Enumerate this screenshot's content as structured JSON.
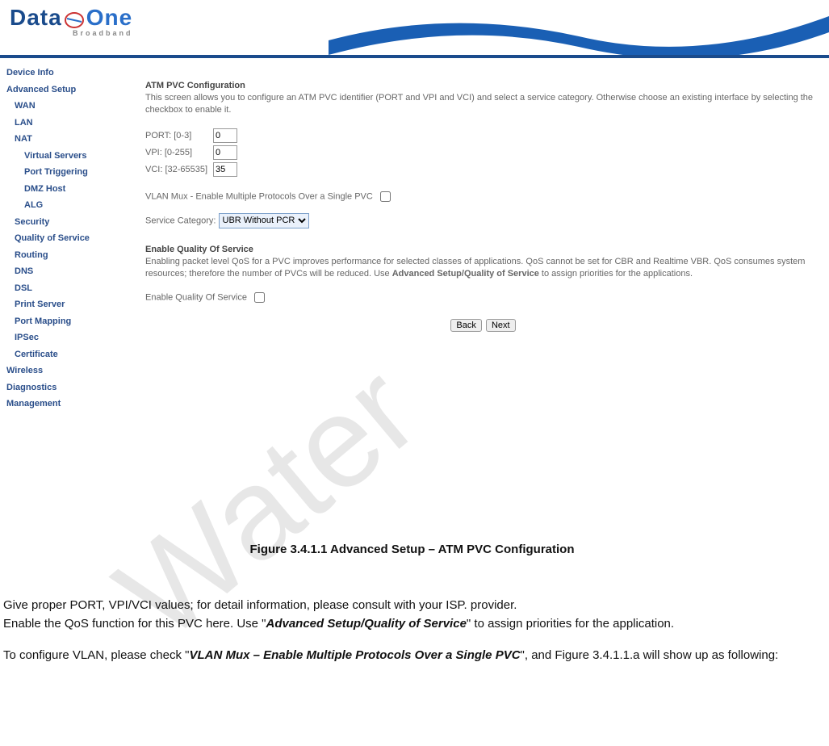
{
  "banner": {
    "logo_main": "Data",
    "logo_accent": "One",
    "logo_sub": "Broadband"
  },
  "sidebar": {
    "items": [
      {
        "label": "Device Info",
        "level": 0
      },
      {
        "label": "Advanced Setup",
        "level": 0
      },
      {
        "label": "WAN",
        "level": 1
      },
      {
        "label": "LAN",
        "level": 1
      },
      {
        "label": "NAT",
        "level": 1
      },
      {
        "label": "Virtual Servers",
        "level": 2
      },
      {
        "label": "Port Triggering",
        "level": 2
      },
      {
        "label": "DMZ Host",
        "level": 2
      },
      {
        "label": "ALG",
        "level": 2
      },
      {
        "label": "Security",
        "level": 1
      },
      {
        "label": "Quality of Service",
        "level": 1
      },
      {
        "label": "Routing",
        "level": 1
      },
      {
        "label": "DNS",
        "level": 1
      },
      {
        "label": "DSL",
        "level": 1
      },
      {
        "label": "Print Server",
        "level": 1
      },
      {
        "label": "Port Mapping",
        "level": 1
      },
      {
        "label": "IPSec",
        "level": 1
      },
      {
        "label": "Certificate",
        "level": 1
      },
      {
        "label": "Wireless",
        "level": 0
      },
      {
        "label": "Diagnostics",
        "level": 0
      },
      {
        "label": "Management",
        "level": 0
      }
    ]
  },
  "content": {
    "title": "ATM PVC Configuration",
    "intro": "This screen allows you to configure an ATM PVC identifier (PORT and VPI and VCI) and select a service category. Otherwise choose an existing interface by selecting the checkbox to enable it.",
    "port_label": "PORT: [0-3]",
    "port_value": "0",
    "vpi_label": "VPI: [0-255]",
    "vpi_value": "0",
    "vci_label": "VCI: [32-65535]",
    "vci_value": "35",
    "vlan_label": "VLAN Mux - Enable Multiple Protocols Over a Single PVC",
    "svc_label": "Service Category:",
    "svc_value": "UBR Without PCR",
    "qos_heading": "Enable Quality Of Service",
    "qos_text_pre": "Enabling packet level QoS for a PVC improves performance for selected classes of applications.  QoS cannot be set for CBR and Realtime VBR.  QoS consumes system resources; therefore the number of PVCs will be reduced. Use ",
    "qos_text_bold": "Advanced Setup/Quality of Service",
    "qos_text_post": " to assign priorities for the applications.",
    "enable_qos_label": "Enable Quality Of Service",
    "back_label": "Back",
    "next_label": "Next"
  },
  "doc": {
    "figure_caption": "Figure 3.4.1.1 Advanced Setup – ATM PVC Configuration",
    "p1": "Give proper PORT, VPI/VCI values; for detail information, please consult with your ISP. provider.",
    "p2_a": "Enable the QoS function for this PVC here. Use \"",
    "p2_em": "Advanced Setup/Quality of Service",
    "p2_b": "\" to assign priorities for the application.",
    "p3_a": "To configure VLAN, please check \"",
    "p3_em": "VLAN Mux – Enable Multiple Protocols Over a Single PVC",
    "p3_b": "\", and Figure 3.4.1.1.a will show up as following:"
  },
  "watermark": "Water"
}
